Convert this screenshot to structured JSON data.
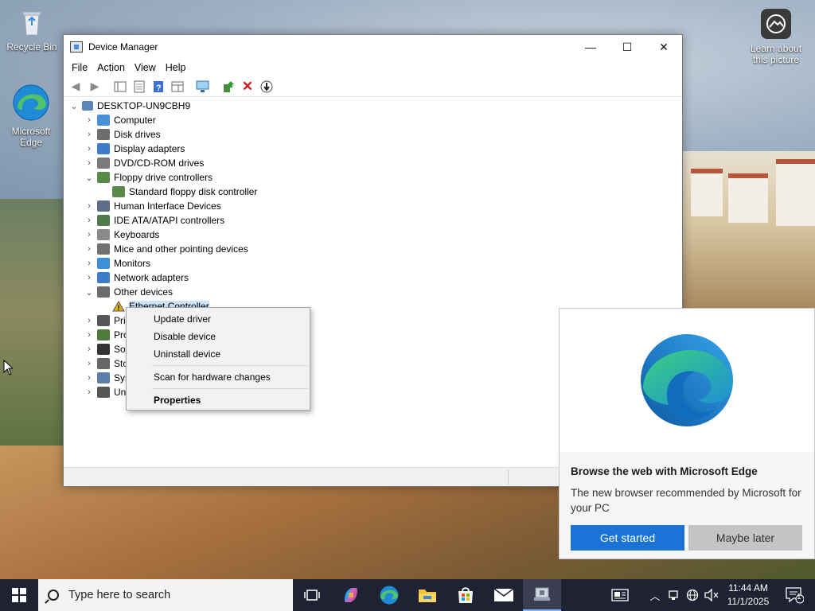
{
  "desktop": {
    "icons": [
      {
        "label": "Recycle Bin"
      },
      {
        "label": "Microsoft Edge"
      },
      {
        "label": "Learn about this picture"
      }
    ]
  },
  "window": {
    "title": "Device Manager",
    "controls": {
      "minimize": "—",
      "maximize": "☐",
      "close": "✕"
    },
    "menu": [
      "File",
      "Action",
      "View",
      "Help"
    ],
    "tree": {
      "root": "DESKTOP-UN9CBH9",
      "items": [
        {
          "label": "Computer",
          "expander": "›",
          "icon_color": "#4a90d9"
        },
        {
          "label": "Disk drives",
          "expander": "›",
          "icon_color": "#6d6d6d"
        },
        {
          "label": "Display adapters",
          "expander": "›",
          "icon_color": "#3d7cc9"
        },
        {
          "label": "DVD/CD-ROM drives",
          "expander": "›",
          "icon_color": "#7a7a7a"
        },
        {
          "label": "Floppy drive controllers",
          "expander": "⌄",
          "icon_color": "#5a8a4a"
        },
        {
          "label": "Standard floppy disk controller",
          "expander": "",
          "icon_color": "#5a8a4a",
          "child": true
        },
        {
          "label": "Human Interface Devices",
          "expander": "›",
          "icon_color": "#5c6f86"
        },
        {
          "label": "IDE ATA/ATAPI controllers",
          "expander": "›",
          "icon_color": "#4f7a4a"
        },
        {
          "label": "Keyboards",
          "expander": "›",
          "icon_color": "#8a8a8a"
        },
        {
          "label": "Mice and other pointing devices",
          "expander": "›",
          "icon_color": "#707070"
        },
        {
          "label": "Monitors",
          "expander": "›",
          "icon_color": "#3d8fd6"
        },
        {
          "label": "Network adapters",
          "expander": "›",
          "icon_color": "#3d7cc9"
        },
        {
          "label": "Other devices",
          "expander": "⌄",
          "icon_color": "#6b6b6b"
        },
        {
          "label": "Ethernet Controller",
          "expander": "",
          "icon_color": "#e0b020",
          "child": true,
          "selected": true
        },
        {
          "label": "Pri",
          "expander": "›",
          "icon_color": "#555555"
        },
        {
          "label": "Pro",
          "expander": "›",
          "icon_color": "#4e7a3e"
        },
        {
          "label": "Sof",
          "expander": "›",
          "icon_color": "#333333"
        },
        {
          "label": "Sto",
          "expander": "›",
          "icon_color": "#666666"
        },
        {
          "label": "Sys",
          "expander": "›",
          "icon_color": "#5a7fa8"
        },
        {
          "label": "Un",
          "expander": "›",
          "icon_color": "#555555"
        }
      ]
    }
  },
  "context_menu": {
    "items": [
      "Update driver",
      "Disable device",
      "Uninstall device"
    ],
    "scan": "Scan for hardware changes",
    "properties": "Properties"
  },
  "edge_flyout": {
    "title": "Browse the web with Microsoft Edge",
    "body": "The new browser recommended by Microsoft for your PC",
    "primary": "Get started",
    "secondary": "Maybe later"
  },
  "taskbar": {
    "search_placeholder": "Type here to search",
    "time": "11:44 AM",
    "date": "11/1/2025",
    "notification_count": "1"
  }
}
